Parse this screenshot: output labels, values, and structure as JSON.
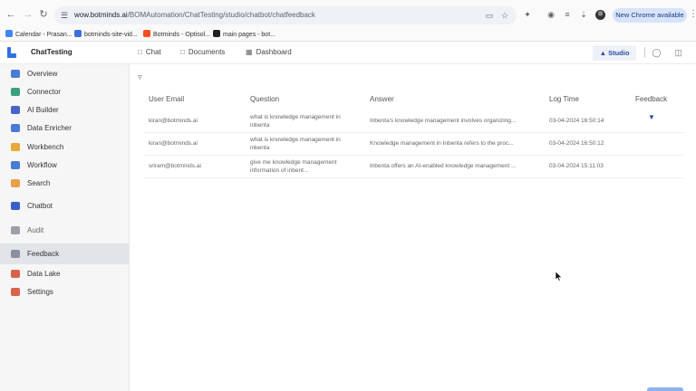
{
  "browser": {
    "url_host": "wow.botminds.ai",
    "url_path": "/BOMAutomation/ChatTesting/studio/chatbot/chatfeedback",
    "new_chrome_label": "New Chrome available",
    "bookmarks": [
      {
        "label": "Calendar - Prasan...",
        "color": "#4285f4"
      },
      {
        "label": "botminds-site-vid...",
        "color": "#3b6fe0"
      },
      {
        "label": "Botminds - Optisol...",
        "color": "#f24e1e"
      },
      {
        "label": "main pages - bot...",
        "color": "#222222"
      }
    ]
  },
  "header": {
    "app_title": "ChatTesting",
    "nav": [
      {
        "label": "Chat",
        "icon": "chat-icon"
      },
      {
        "label": "Documents",
        "icon": "document-icon"
      },
      {
        "label": "Dashboard",
        "icon": "dashboard-icon"
      }
    ],
    "studio_label": "Studio"
  },
  "sidebar": {
    "items": [
      {
        "label": "Overview",
        "icon": "overview-icon",
        "color": "#4a7bd8"
      },
      {
        "label": "Connector",
        "icon": "connector-icon",
        "color": "#3aa07a"
      },
      {
        "label": "AI Builder",
        "icon": "ai-builder-icon",
        "color": "#4a63c8"
      },
      {
        "label": "Data Enricher",
        "icon": "data-enricher-icon",
        "color": "#4a7bd8"
      },
      {
        "label": "Workbench",
        "icon": "workbench-icon",
        "color": "#e6a93a"
      },
      {
        "label": "Workflow",
        "icon": "workflow-icon",
        "color": "#4a7bd8"
      },
      {
        "label": "Search",
        "icon": "search-icon",
        "color": "#e8a04a"
      },
      {
        "label": "Chatbot",
        "icon": "chatbot-icon",
        "color": "#3a5fc8"
      },
      {
        "label": "Audit",
        "icon": "audit-icon",
        "color": "#9aa0aa"
      },
      {
        "label": "Feedback",
        "icon": "feedback-icon",
        "color": "#8a90a0"
      },
      {
        "label": "Data Lake",
        "icon": "data-lake-icon",
        "color": "#d9634a"
      },
      {
        "label": "Settings",
        "icon": "settings-icon",
        "color": "#d9634a"
      }
    ]
  },
  "table": {
    "columns": [
      "User Email",
      "Question",
      "Answer",
      "Log Time",
      "Feedback"
    ],
    "rows": [
      {
        "email": "kiran@botminds.ai",
        "question": "what is knowledge management in inbenta",
        "answer": "Inbenta's knowledge management involves organizing...",
        "log_time": "03-04-2024 16:50:14",
        "feedback": "thumbs-down"
      },
      {
        "email": "kiran@botminds.ai",
        "question": "what is knowledge management in inbenta",
        "answer": "Knowledge management in Inbenta refers to the proc...",
        "log_time": "03-04-2024 16:50:12",
        "feedback": ""
      },
      {
        "email": "sriram@botminds.ai",
        "question": "give me knowledge management information of inbent...",
        "answer": "Inbenta offers an AI-enabled knowledge management ...",
        "log_time": "03-04-2024 15:11:03",
        "feedback": ""
      }
    ]
  }
}
